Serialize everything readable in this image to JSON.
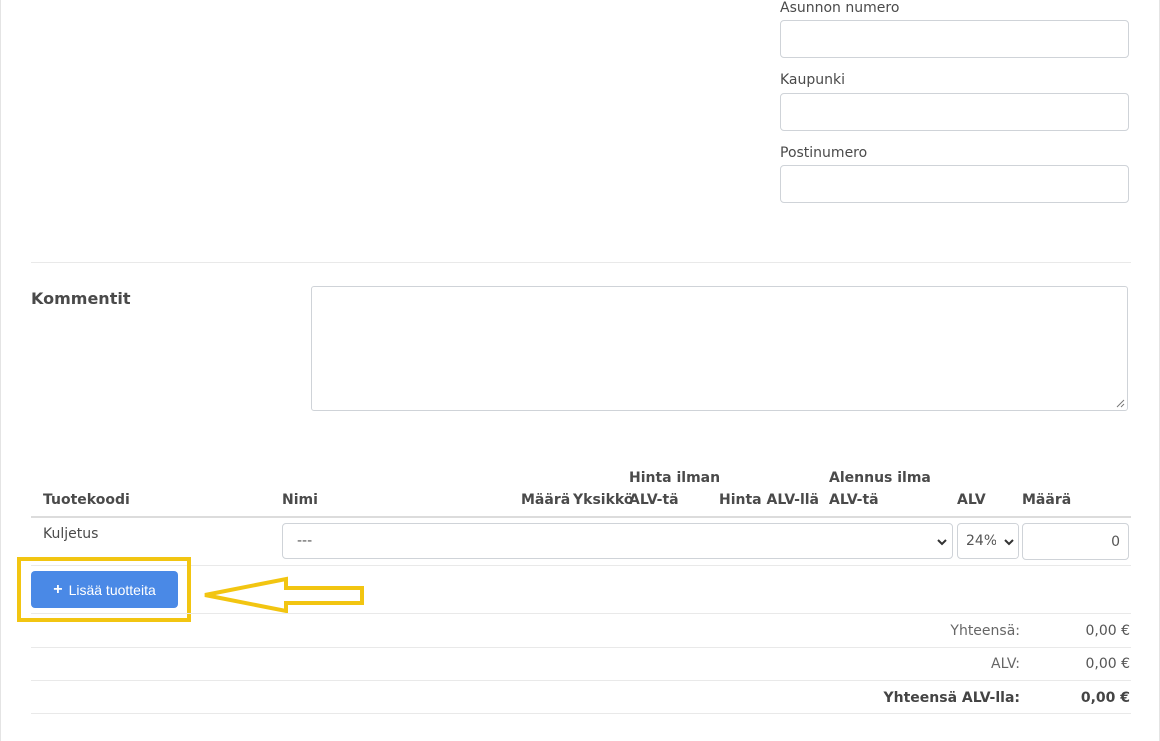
{
  "address": {
    "apartment_label": "Asunnon numero",
    "apartment_value": "",
    "city_label": "Kaupunki",
    "city_value": "",
    "postal_label": "Postinumero",
    "postal_value": ""
  },
  "comments": {
    "title": "Kommentit",
    "value": ""
  },
  "table": {
    "headers": {
      "code": "Tuotekoodi",
      "name": "Nimi",
      "amount": "Määrä",
      "unit": "Yksikkö",
      "price_ex_line1": "Hinta ilman",
      "price_ex_line2": "ALV-tä",
      "price_incl": "Hinta ALV-llä",
      "discount_line1": "Alennus ilma",
      "discount_line2": "ALV-tä",
      "vat": "ALV",
      "quantity": "Määrä"
    },
    "rows": [
      {
        "code": "Kuljetus",
        "name_select": "---",
        "vat_select": "24%",
        "quantity": "0"
      }
    ]
  },
  "add_products_button": "Lisää tuotteita",
  "totals": {
    "subtotal_label": "Yhteensä:",
    "subtotal_value": "0,00 €",
    "vat_label": "ALV:",
    "vat_value": "0,00 €",
    "total_label": "Yhteensä ALV-lla:",
    "total_value": "0,00 €"
  },
  "colors": {
    "accent_button": "#4a89e6",
    "highlight": "#f2c511"
  },
  "icons": [
    "plus-icon",
    "chevron-down-icon",
    "arrow-left-icon",
    "resize-grip-icon"
  ]
}
